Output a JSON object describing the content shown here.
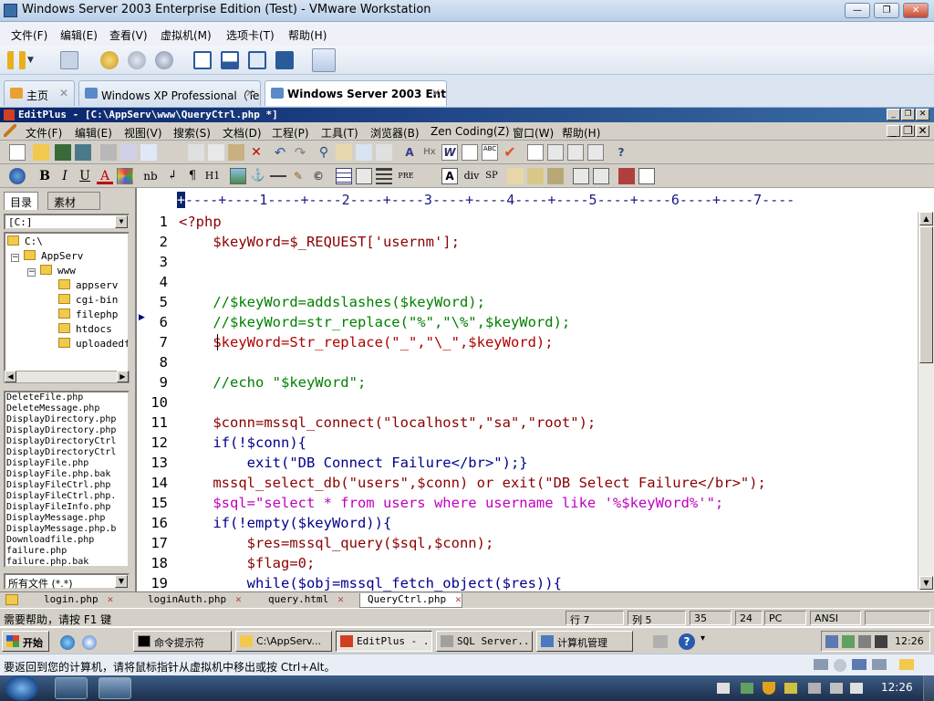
{
  "vmware": {
    "title": "Windows Server 2003 Enterprise Edition (Test) - VMware Workstation",
    "menu": [
      "文件(F)",
      "编辑(E)",
      "查看(V)",
      "虚拟机(M)",
      "选项卡(T)",
      "帮助(H)"
    ],
    "tabs": [
      {
        "label": "主页"
      },
      {
        "label": "Windows XP Professional（Te..."
      },
      {
        "label": "Windows Server 2003 Ent..."
      }
    ],
    "status": "要返回到您的计算机，请将鼠标指针从虚拟机中移出或按 Ctrl+Alt。"
  },
  "editplus": {
    "title": "EditPlus - [C:\\AppServ\\www\\QueryCtrl.php *]",
    "menu": [
      "文件(F)",
      "编辑(E)",
      "视图(V)",
      "搜索(S)",
      "文档(D)",
      "工程(P)",
      "工具(T)",
      "浏览器(B)",
      "Zen Coding(Z)",
      "窗口(W)",
      "帮助(H)"
    ],
    "toolbar2_labels": [
      "B",
      "I",
      "U",
      "A",
      "nb",
      "¶",
      "H1",
      "PRE",
      "div",
      "SP"
    ],
    "left_tabs": [
      "目录",
      "素材"
    ],
    "drive": "[C:]",
    "tree": [
      "C:\\",
      "AppServ",
      "www",
      "appserv",
      "cgi-bin",
      "filephp",
      "htdocs",
      "uploadedfi"
    ],
    "files": [
      "DeleteFile.php",
      "DeleteMessage.php",
      "DisplayDirectory.php",
      "DisplayDirectory.php",
      "DisplayDirectoryCtrl",
      "DisplayDirectoryCtrl",
      "DisplayFile.php",
      "DisplayFile.php.bak",
      "DisplayFileCtrl.php",
      "DisplayFileCtrl.php.",
      "DisplayFileInfo.php",
      "DisplayMessage.php",
      "DisplayMessage.php.b",
      "Downloadfile.php",
      "failure.php",
      "failure.php.bak"
    ],
    "filter": "所有文件 (*.*)",
    "ruler": "----+----1----+----2----+----3----+----4----+----5----+----6----+----7----",
    "code": [
      {
        "n": "1",
        "t": "<?php",
        "c": "#8b0000"
      },
      {
        "n": "2",
        "t": "    $keyWord=$_REQUEST['usernm'];",
        "c": "#8b0000"
      },
      {
        "n": "3",
        "t": "",
        "c": "#000"
      },
      {
        "n": "4",
        "t": "",
        "c": "#000"
      },
      {
        "n": "5",
        "t": "    //$keyWord=addslashes($keyWord);",
        "c": "#008000"
      },
      {
        "n": "6",
        "t": "    //$keyWord=str_replace(\"%\",\"\\%\",$keyWord);",
        "c": "#008000"
      },
      {
        "n": "7",
        "t": "    $keyWord=Str_replace(\"_\",\"\\_\",$keyWord);",
        "c": "#b00000"
      },
      {
        "n": "8",
        "t": "",
        "c": "#000"
      },
      {
        "n": "9",
        "t": "    //echo \"$keyWord\";",
        "c": "#008000"
      },
      {
        "n": "10",
        "t": "",
        "c": "#000"
      },
      {
        "n": "11",
        "t": "    $conn=mssql_connect(\"localhost\",\"sa\",\"root\");",
        "c": "#8b0000"
      },
      {
        "n": "12",
        "t": "    if(!$conn){",
        "c": "#00008b"
      },
      {
        "n": "13",
        "t": "        exit(\"DB Connect Failure</br>\");}",
        "c": "#00008b"
      },
      {
        "n": "14",
        "t": "    mssql_select_db(\"users\",$conn) or exit(\"DB Select Failure</br>\");",
        "c": "#8b0000"
      },
      {
        "n": "15",
        "t": "    $sql=\"select * from users where username like '%$keyWord%'\";",
        "c": "#c000c0"
      },
      {
        "n": "16",
        "t": "    if(!empty($keyWord)){",
        "c": "#00008b"
      },
      {
        "n": "17",
        "t": "        $res=mssql_query($sql,$conn);",
        "c": "#8b0000"
      },
      {
        "n": "18",
        "t": "        $flag=0;",
        "c": "#8b0000"
      },
      {
        "n": "19",
        "t": "        while($obj=mssql_fetch_object($res)){",
        "c": "#00008b"
      }
    ],
    "doc_tabs": [
      "login.php",
      "loginAuth.php",
      "query.html",
      "QueryCtrl.php"
    ],
    "status": {
      "help": "需要帮助，请按 F1 键",
      "row": "行 7",
      "col": "列 5",
      "n1": "35",
      "n2": "24",
      "mode": "PC",
      "enc": "ANSI"
    }
  },
  "xp_taskbar": {
    "start": "开始",
    "items": [
      "命令提示符",
      "C:\\AppServ...",
      "EditPlus - ...",
      "SQL Server...",
      "计算机管理"
    ],
    "clock": "12:26"
  },
  "win7_clock": "12:26",
  "colors": {
    "keyword_var": "#008080",
    "string": "#b000b0",
    "comment": "#008000",
    "php_tag": "#8b0000",
    "titlebar": "#0a246a"
  }
}
